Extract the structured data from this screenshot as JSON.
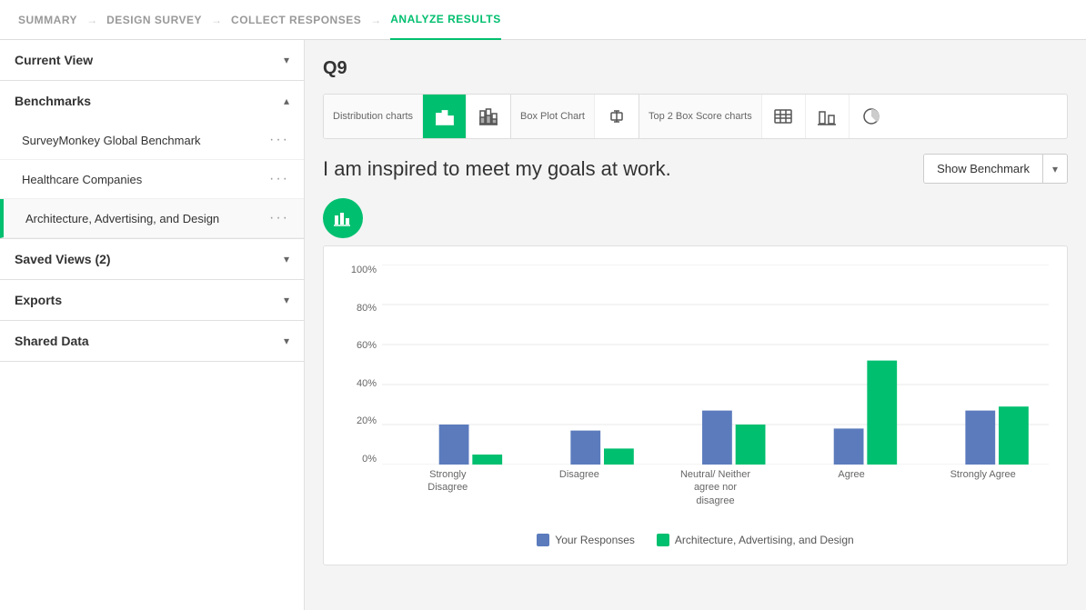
{
  "topnav": {
    "steps": [
      {
        "id": "summary",
        "label": "SUMMARY",
        "active": false
      },
      {
        "id": "design-survey",
        "label": "DESIGN SURVEY",
        "active": false
      },
      {
        "id": "collect-responses",
        "label": "COLLECT RESPONSES",
        "active": false
      },
      {
        "id": "analyze-results",
        "label": "ANALYZE RESULTS",
        "active": true
      }
    ]
  },
  "sidebar": {
    "current_view": {
      "label": "Current View"
    },
    "benchmarks": {
      "label": "Benchmarks",
      "items": [
        {
          "id": "global",
          "label": "SurveyMonkey Global Benchmark",
          "active": false
        },
        {
          "id": "healthcare",
          "label": "Healthcare Companies",
          "active": false
        },
        {
          "id": "architecture",
          "label": "Architecture, Advertising, and Design",
          "active": true
        }
      ]
    },
    "saved_views": {
      "label": "Saved Views (2)"
    },
    "exports": {
      "label": "Exports"
    },
    "shared_data": {
      "label": "Shared Data"
    }
  },
  "main": {
    "question_id": "Q9",
    "chart_groups": [
      {
        "label": "Distribution charts",
        "buttons": [
          {
            "id": "bar-chart",
            "selected": true,
            "icon": "bar"
          },
          {
            "id": "stacked-bar",
            "selected": false,
            "icon": "stacked"
          }
        ]
      },
      {
        "label": "Box Plot Chart",
        "buttons": [
          {
            "id": "box-plot",
            "selected": false,
            "icon": "boxplot"
          }
        ]
      },
      {
        "label": "Top 2 Box Score charts",
        "buttons": [
          {
            "id": "table-chart",
            "selected": false,
            "icon": "table"
          },
          {
            "id": "bar-chart-2",
            "selected": false,
            "icon": "bar2"
          },
          {
            "id": "circle-chart",
            "selected": false,
            "icon": "circle"
          }
        ]
      }
    ],
    "question_text": "I am inspired to meet my goals at work.",
    "show_benchmark_label": "Show Benchmark",
    "chart": {
      "y_labels": [
        "100%",
        "80%",
        "60%",
        "40%",
        "20%",
        "0%"
      ],
      "x_labels": [
        "Strongly Disagree",
        "Disagree",
        "Neutral/ Neither agree nor disagree",
        "Agree",
        "Strongly Agree"
      ],
      "bars": [
        {
          "category": "Strongly Disagree",
          "blue": 20,
          "green": 5
        },
        {
          "category": "Disagree",
          "blue": 17,
          "green": 8
        },
        {
          "category": "Neutral/Neither agree nor disagree",
          "blue": 27,
          "green": 20
        },
        {
          "category": "Agree",
          "blue": 18,
          "green": 52
        },
        {
          "category": "Strongly Agree",
          "blue": 27,
          "green": 29
        }
      ],
      "legend": [
        {
          "id": "your-responses",
          "label": "Your Responses",
          "color": "#5b7bbd"
        },
        {
          "id": "architecture",
          "label": "Architecture, Advertising, and Design",
          "color": "#00bf6f"
        }
      ]
    }
  }
}
